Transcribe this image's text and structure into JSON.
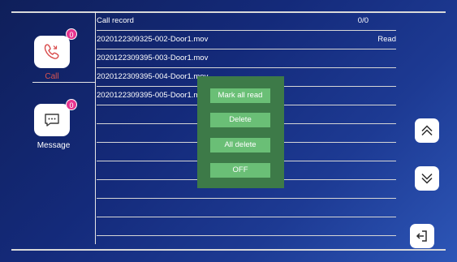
{
  "sidebar": {
    "call_label": "Call",
    "call_badge": "0",
    "message_label": "Message",
    "message_badge": "0"
  },
  "table": {
    "header_title": "Call record",
    "header_count": "0/0",
    "rows": [
      {
        "name": "2020122309325-002-Door1.mov",
        "status": "Read"
      },
      {
        "name": "2020122309395-003-Door1.mov",
        "status": ""
      },
      {
        "name": "2020122309395-004-Door1.mov",
        "status": ""
      },
      {
        "name": "2020122309395-005-Door1.mov",
        "status": ""
      }
    ]
  },
  "popup": {
    "mark_all_read": "Mark all read",
    "delete": "Delete",
    "all_delete": "All delete",
    "off": "OFF"
  },
  "colors": {
    "background": "#142a7a",
    "call_badge": "#e6358f",
    "call_label": "#d9534f",
    "popup_bg": "#3d7a48",
    "popup_button": "#6abf76"
  },
  "icons": {
    "call": "phone-icon",
    "message": "chat-bubble-icon",
    "scroll_up": "double-chevron-up-icon",
    "scroll_down": "double-chevron-down-icon",
    "exit": "exit-icon"
  }
}
